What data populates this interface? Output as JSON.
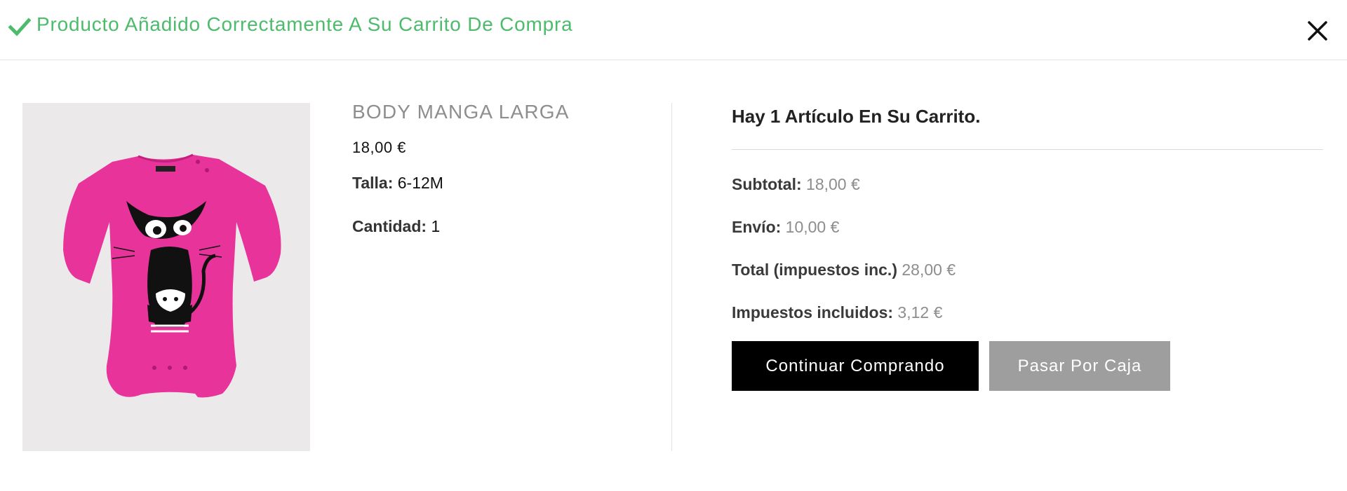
{
  "header": {
    "title": "Producto Añadido Correctamente A Su Carrito De Compra",
    "check_icon": "check-icon",
    "close_icon": "close-icon",
    "accent_color": "#4cbb6c"
  },
  "product": {
    "name": "BODY MANGA LARGA",
    "price": "18,00 €",
    "size_label": "Talla:",
    "size_value": "6-12M",
    "quantity_label": "Cantidad:",
    "quantity_value": "1",
    "color": "#e8339a"
  },
  "cart": {
    "count_text": "Hay 1 Artículo En Su Carrito.",
    "subtotal_label": "Subtotal:",
    "subtotal_value": "18,00 €",
    "shipping_label": "Envío:",
    "shipping_value": "10,00 €",
    "total_label": "Total (impuestos inc.)",
    "total_value": "28,00 €",
    "taxes_label": "Impuestos incluidos:",
    "taxes_value": "3,12 €"
  },
  "buttons": {
    "continue_label": "Continuar Comprando",
    "checkout_label": "Pasar Por Caja"
  }
}
